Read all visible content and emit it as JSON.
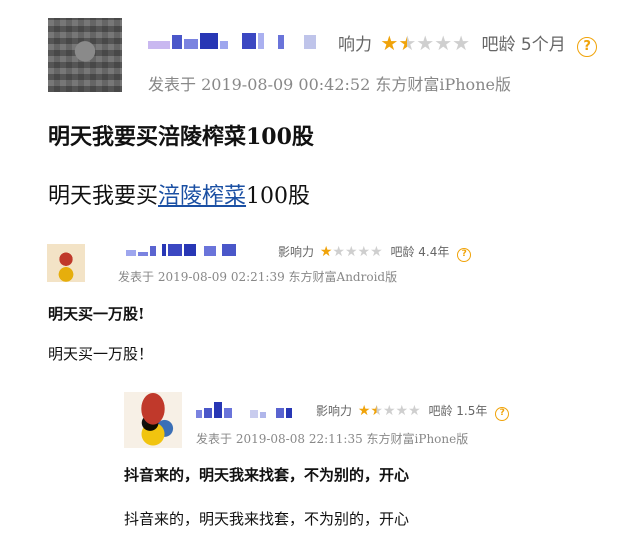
{
  "posts": [
    {
      "meta": {
        "influence_label": "响力",
        "stars": [
          1,
          0.5,
          0,
          0,
          0
        ],
        "age_label": "吧龄 5个月",
        "help": "?"
      },
      "posted": "发表于 2019-08-09 00:42:52 东方财富iPhone版",
      "title": "明天我要买涪陵榨菜100股",
      "body_prefix": "明天我要买",
      "body_link": "涪陵榨菜",
      "body_suffix": "100股"
    },
    {
      "meta": {
        "influence_label": "影响力",
        "stars": [
          1,
          0,
          0,
          0,
          0
        ],
        "age_label": "吧龄 4.4年",
        "help": "?"
      },
      "posted": "发表于 2019-08-09 02:21:39 东方财富Android版",
      "title": "明天买一万股!",
      "body": "明天买一万股！"
    },
    {
      "meta": {
        "influence_label": "影响力",
        "stars": [
          1,
          0.5,
          0,
          0,
          0
        ],
        "age_label": "吧龄 1.5年",
        "help": "?"
      },
      "posted": "发表于 2019-08-08 22:11:35 东方财富iPhone版",
      "title": "抖音来的，明天我来找套，不为别的，开心",
      "body": "抖音来的，明天我来找套，不为别的，开心"
    }
  ]
}
